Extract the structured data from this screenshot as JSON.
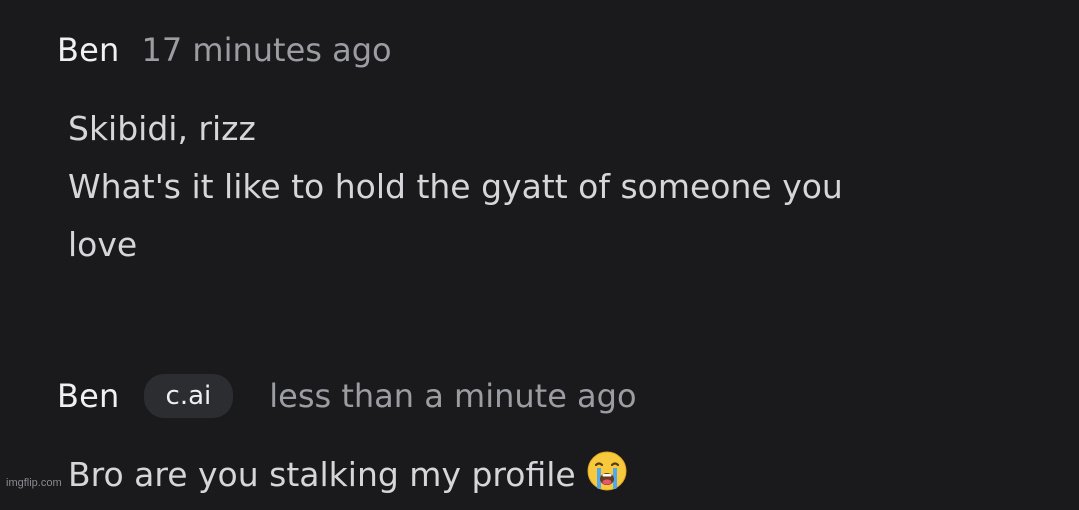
{
  "messages": [
    {
      "author": "Ben",
      "badge": "",
      "timestamp": "17 minutes ago",
      "lines": [
        "Skibidi, rizz",
        "What's it like to hold the gyatt of someone you",
        "love"
      ]
    },
    {
      "author": "Ben",
      "badge": "c.ai",
      "timestamp": "less than a minute ago",
      "lines": [
        "Bro are you stalking my profile"
      ],
      "emoji": "loudly-crying-face-icon"
    }
  ],
  "watermark": "imgflip.com",
  "colors": {
    "background": "#1a1a1d",
    "author": "#f0f0f2",
    "timestamp": "#9c9ca3",
    "body_text": "#d6d6da",
    "badge_bg": "#2c2d31"
  }
}
